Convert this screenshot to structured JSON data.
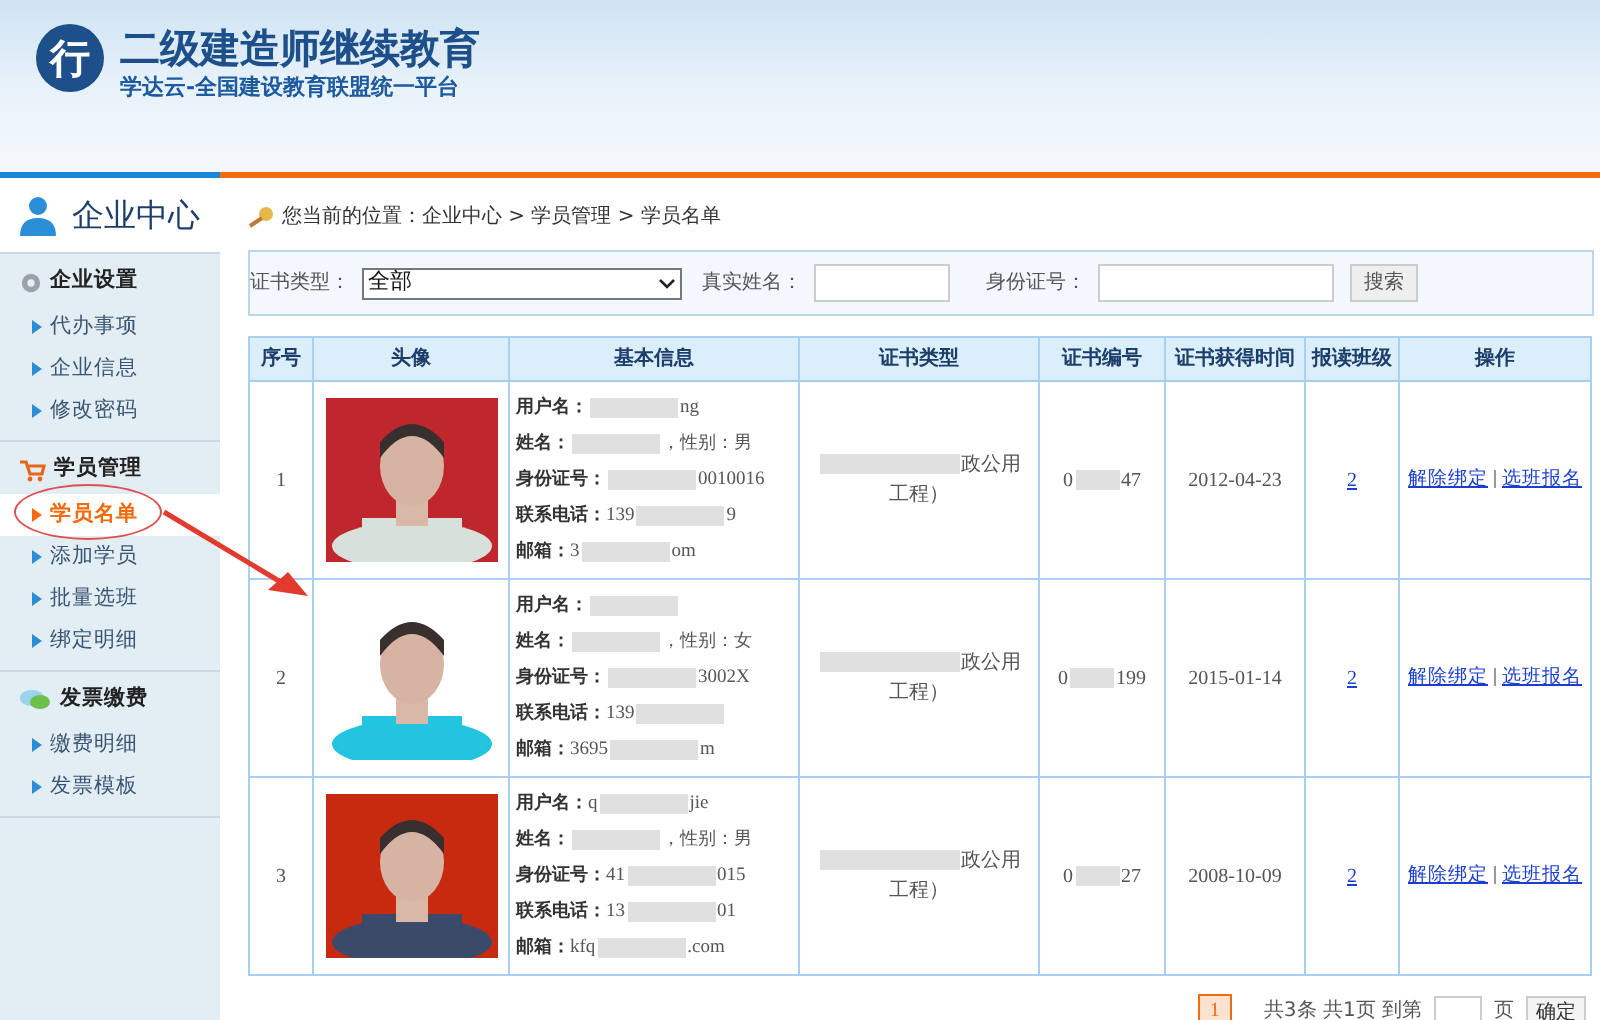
{
  "header": {
    "title": "二级建造师继续教育",
    "subtitle": "学达云-全国建设教育联盟统一平台",
    "logo_char": "行"
  },
  "sidebar": {
    "title": "企业中心",
    "groups": [
      {
        "kind": "gear",
        "title": "企业设置",
        "items": [
          {
            "label": "代办事项",
            "selected": false
          },
          {
            "label": "企业信息",
            "selected": false
          },
          {
            "label": "修改密码",
            "selected": false
          }
        ]
      },
      {
        "kind": "cart",
        "title": "学员管理",
        "items": [
          {
            "label": "学员名单",
            "selected": true
          },
          {
            "label": "添加学员",
            "selected": false
          },
          {
            "label": "批量选班",
            "selected": false
          },
          {
            "label": "绑定明细",
            "selected": false
          }
        ]
      },
      {
        "kind": "chat",
        "title": "发票缴费",
        "items": [
          {
            "label": "缴费明细",
            "selected": false
          },
          {
            "label": "发票模板",
            "selected": false
          }
        ]
      }
    ]
  },
  "breadcrumb": "您当前的位置：企业中心 > 学员管理 > 学员名单",
  "filters": {
    "cert_type_label": "证书类型：",
    "cert_type_value": "全部",
    "name_label": "真实姓名：",
    "id_label": "身份证号：",
    "search_button": "搜索"
  },
  "table": {
    "columns": [
      "序号",
      "头像",
      "基本信息",
      "证书类型",
      "证书编号",
      "证书获得时间",
      "报读班级",
      "操作"
    ],
    "rows": [
      {
        "index": "1",
        "photo": {
          "kind": "picture"
        },
        "info": [
          {
            "label": "用户名：",
            "suffix": "ng"
          },
          {
            "label": "姓名：",
            "after": "，性别：男"
          },
          {
            "label": "身份证号：",
            "suffix": "0010016"
          },
          {
            "label": "联系电话：",
            "prefix": "139",
            "suffix": "9"
          },
          {
            "label": "邮箱：",
            "prefix": "3",
            "suffix": "om"
          }
        ],
        "cert_type": "政公用工程）",
        "cert_no": {
          "prefix": "0",
          "suffix": "47"
        },
        "date": "2012-04-23",
        "classes": "2",
        "actions": [
          "解除绑定",
          "选班报名"
        ]
      },
      {
        "index": "2",
        "photo": {
          "kind": "picture"
        },
        "info": [
          {
            "label": "用户名："
          },
          {
            "label": "姓名：",
            "after": "，性别：女"
          },
          {
            "label": "身份证号：",
            "suffix": "3002X"
          },
          {
            "label": "联系电话：",
            "prefix": "139"
          },
          {
            "label": "邮箱：",
            "prefix": "3695",
            "suffix": "m"
          }
        ],
        "cert_type": "政公用工程）",
        "cert_no": {
          "prefix": "0",
          "suffix": "199"
        },
        "date": "2015-01-14",
        "classes": "2",
        "actions": [
          "解除绑定",
          "选班报名"
        ]
      },
      {
        "index": "3",
        "photo": {
          "kind": "picture"
        },
        "info": [
          {
            "label": "用户名：",
            "prefix": "q",
            "suffix": "jie"
          },
          {
            "label": "姓名：",
            "after": "，性别：男"
          },
          {
            "label": "身份证号：",
            "prefix": "41",
            "suffix": "015"
          },
          {
            "label": "联系电话：",
            "prefix": "13",
            "suffix": "01"
          },
          {
            "label": "邮箱：",
            "prefix": "kfq",
            "suffix": ".com"
          }
        ],
        "cert_type": "政公用工程）",
        "cert_no": {
          "prefix": "0",
          "suffix": "27"
        },
        "date": "2008-10-09",
        "classes": "2",
        "actions": [
          "解除绑定",
          "选班报名"
        ]
      }
    ]
  },
  "pagination": {
    "pages": [
      {
        "label": "1",
        "selected": true
      }
    ],
    "summary": "共3条 共1页 到第",
    "page_unit": "页",
    "go_button": "确定"
  }
}
